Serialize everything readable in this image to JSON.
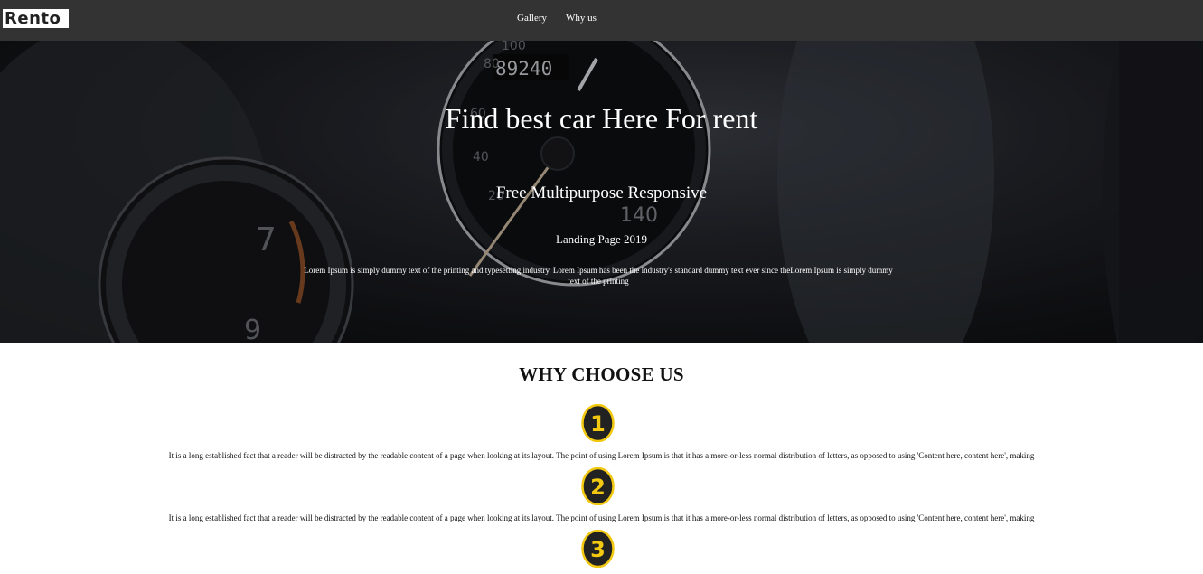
{
  "brand": {
    "logo_text": "Rento"
  },
  "nav": {
    "items": [
      {
        "label": "Gallery"
      },
      {
        "label": "Why us"
      }
    ]
  },
  "hero": {
    "title": "Find best car Here For rent",
    "subtitle": "Free Multipurpose Responsive",
    "year_line": "Landing Page 2019",
    "description": "Lorem Ipsum is simply dummy text of the printing and typesetting industry. Lorem Ipsum has been the industry's standard dummy text ever since theLorem Ipsum is simply dummy text of the printing",
    "dial_numbers": [
      "100",
      "80",
      "60",
      "40",
      "20",
      "140",
      "7",
      "9"
    ],
    "odometer": "89240"
  },
  "why": {
    "title": "WHY CHOOSE US",
    "items": [
      {
        "number": "1",
        "text": "It is a long established fact that a reader will be distracted by the readable content of a page when looking at its layout. The point of using Lorem Ipsum is that it has a more-or-less normal distribution of letters, as opposed to using 'Content here, content here', making"
      },
      {
        "number": "2",
        "text": "It is a long established fact that a reader will be distracted by the readable content of a page when looking at its layout. The point of using Lorem Ipsum is that it has a more-or-less normal distribution of letters, as opposed to using 'Content here, content here', making"
      },
      {
        "number": "3",
        "text": ""
      }
    ]
  },
  "colors": {
    "navbar": "#333333",
    "badge_fill": "#222222",
    "badge_accent": "#f2c811",
    "gauge_needle": "#c9b49b"
  }
}
